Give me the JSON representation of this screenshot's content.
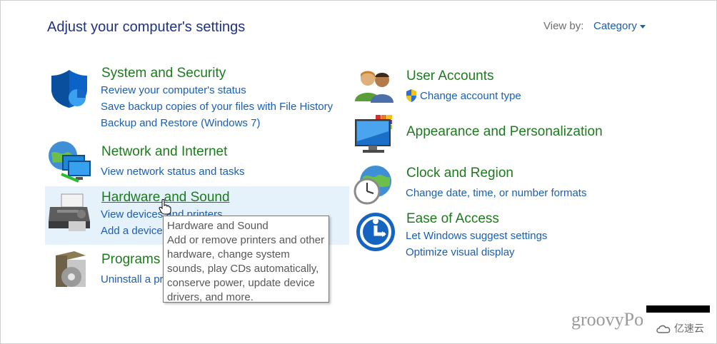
{
  "header": {
    "title": "Adjust your computer's settings",
    "view_by_label": "View by:",
    "view_by_value": "Category"
  },
  "left_column": [
    {
      "title": "System and Security",
      "icon": "shield-icon",
      "links": [
        "Review your computer's status",
        "Save backup copies of your files with File History",
        "Backup and Restore (Windows 7)"
      ]
    },
    {
      "title": "Network and Internet",
      "icon": "network-globe-icon",
      "links": [
        "View network status and tasks"
      ]
    },
    {
      "title": "Hardware and Sound",
      "icon": "printer-icon",
      "links": [
        "View devices and printers",
        "Add a device"
      ]
    },
    {
      "title": "Programs",
      "icon": "programs-disc-icon",
      "links": [
        "Uninstall a program"
      ]
    }
  ],
  "right_column": [
    {
      "title": "User Accounts",
      "icon": "users-icon",
      "links": [
        "Change account type"
      ]
    },
    {
      "title": "Appearance and Personalization",
      "icon": "monitor-palette-icon",
      "links": []
    },
    {
      "title": "Clock and Region",
      "icon": "clock-globe-icon",
      "links": [
        "Change date, time, or number formats"
      ]
    },
    {
      "title": "Ease of Access",
      "icon": "ease-of-access-icon",
      "links": [
        "Let Windows suggest settings",
        "Optimize visual display"
      ]
    }
  ],
  "tooltip": {
    "title": "Hardware and Sound",
    "body": "Add or remove printers and other hardware, change system sounds, play CDs automatically, conserve power, update device drivers, and more."
  },
  "watermark": {
    "text": "groovyPo",
    "brand": "亿速云"
  },
  "colors": {
    "title_blue": "#1e3287",
    "link_blue": "#1a5fb4",
    "category_green": "#1e7a1e",
    "hover_bg": "#e5f1fb"
  }
}
